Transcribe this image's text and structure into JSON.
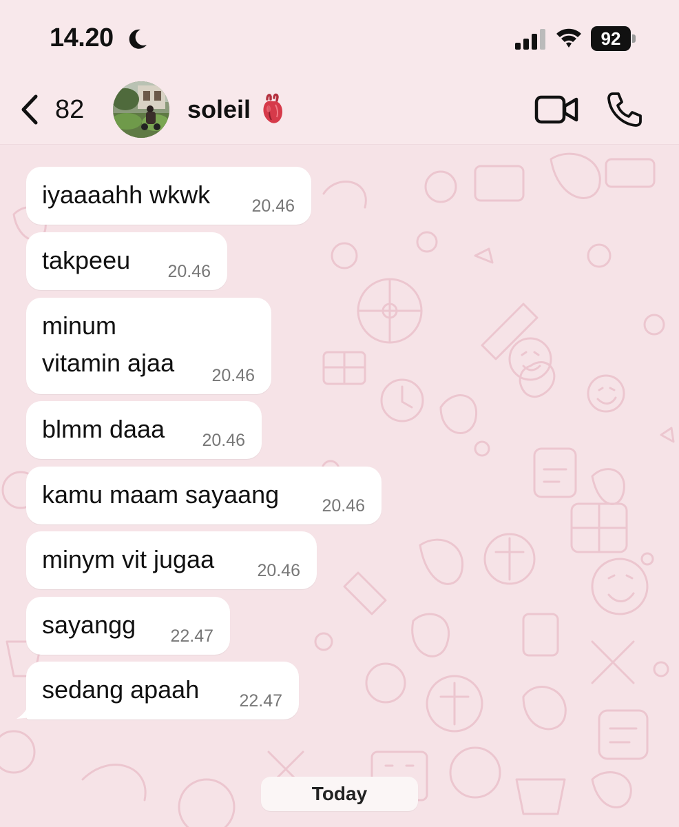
{
  "status_bar": {
    "time": "14.20",
    "battery": "92",
    "icons": [
      "moon-icon",
      "signal-icon",
      "wifi-icon",
      "battery-icon"
    ]
  },
  "header": {
    "back_count": "82",
    "contact_name": "soleil",
    "name_emoji": "anatomical-heart-icon",
    "actions": [
      "video-call-icon",
      "voice-call-icon"
    ]
  },
  "messages": [
    {
      "text": "iyaaaahh wkwk",
      "time": "20.46"
    },
    {
      "text": "takpeeu",
      "time": "20.46"
    },
    {
      "text": "minum\nvitamin ajaa",
      "time": "20.46"
    },
    {
      "text": "blmm daaa",
      "time": "20.46"
    },
    {
      "text": "kamu maam sayaang",
      "time": "20.46"
    },
    {
      "text": "minym vit jugaa",
      "time": "20.46"
    },
    {
      "text": "sayangg",
      "time": "22.47"
    },
    {
      "text": "sedang apaah",
      "time": "22.47"
    }
  ],
  "date_separator": "Today",
  "colors": {
    "background": "#f6e3e7",
    "bubble": "#ffffff",
    "pattern": "#ecc7cf",
    "heart": "#d63a4a"
  }
}
